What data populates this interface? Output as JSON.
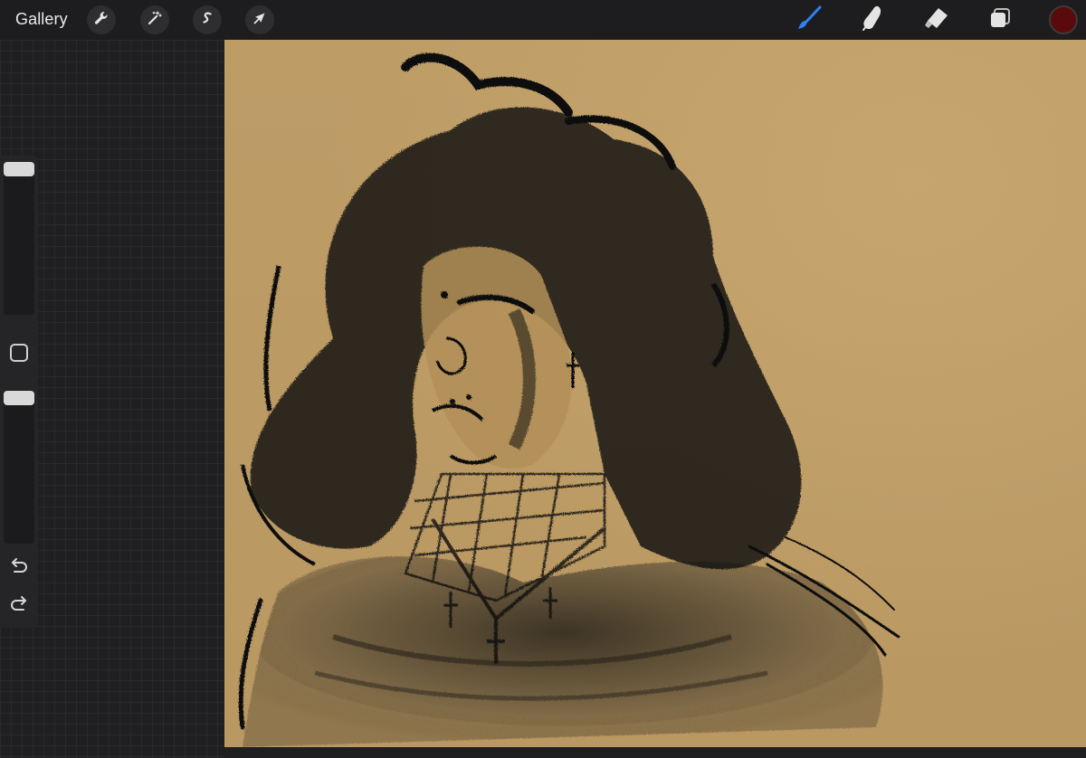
{
  "toolbar": {
    "gallery_label": "Gallery",
    "actions_icon": "wrench-icon",
    "adjustments_icon": "magic-wand-icon",
    "selection_icon": "selection-s-icon",
    "transform_icon": "arrow-cursor-icon",
    "brush_icon": "brush-icon",
    "smudge_icon": "smudge-finger-icon",
    "eraser_icon": "eraser-icon",
    "layers_icon": "layers-icon",
    "active_tool": "brush",
    "accent_color": "#1a73e8",
    "current_color": "#5a0a0a"
  },
  "sidebar": {
    "brush_size_level": 1.0,
    "opacity_level": 1.0,
    "modify_icon": "square-modify-icon",
    "undo_icon": "undo-arrow-icon",
    "redo_icon": "redo-arrow-icon"
  },
  "canvas": {
    "paper_color": "#bd9c66",
    "ink_color": "#111111"
  }
}
